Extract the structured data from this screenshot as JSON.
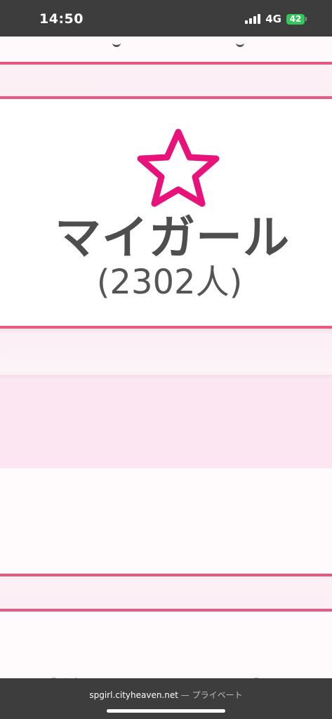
{
  "status_bar": {
    "time": "14:50",
    "network": "4G",
    "battery_level": "42"
  },
  "mygirl": {
    "title": "マイガール",
    "count": "(2302人)"
  },
  "bottom_heading_partial": "店様にアニメ投",
  "address_bar": {
    "domain": "spgirl.cityheaven.net",
    "separator": "—",
    "mode": "プライベート"
  },
  "colors": {
    "accent_pink": "#e65a82",
    "star_pink": "#e8137a",
    "status_bar_bg": "#3d3d3d",
    "battery_green": "#35c759"
  }
}
